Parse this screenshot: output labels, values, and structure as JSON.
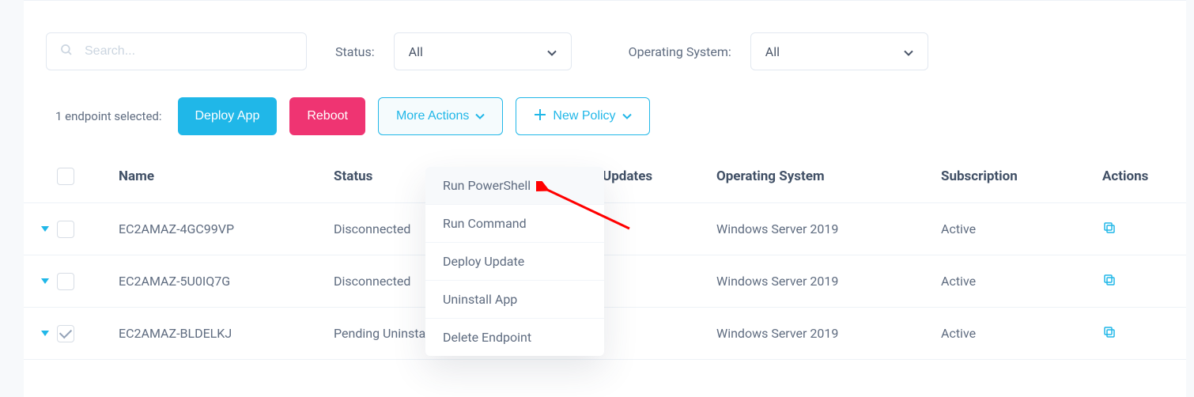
{
  "filters": {
    "search_placeholder": "Search...",
    "status_label": "Status:",
    "status_value": "All",
    "os_label": "Operating System:",
    "os_value": "All"
  },
  "toolbar": {
    "selection_text": "1 endpoint selected:",
    "deploy_app": "Deploy App",
    "reboot": "Reboot",
    "more_actions": "More Actions",
    "new_policy": "New Policy"
  },
  "more_actions_menu": [
    "Run PowerShell",
    "Run Command",
    "Deploy Update",
    "Uninstall App",
    "Delete Endpoint"
  ],
  "columns": {
    "name": "Name",
    "status": "Status",
    "updates": "Updates",
    "os": "Operating System",
    "subscription": "Subscription",
    "actions": "Actions"
  },
  "rows": [
    {
      "name": "EC2AMAZ-4GC99VP",
      "status": "Disconnected",
      "updates": "",
      "os": "Windows Server 2019",
      "subscription": "Active",
      "checked": false
    },
    {
      "name": "EC2AMAZ-5U0IQ7G",
      "status": "Disconnected",
      "updates": "",
      "os": "Windows Server 2019",
      "subscription": "Active",
      "checked": false
    },
    {
      "name": "EC2AMAZ-BLDELKJ",
      "status": "Pending Uninstall",
      "updates": "",
      "os": "Windows Server 2019",
      "subscription": "Active",
      "checked": true
    }
  ]
}
